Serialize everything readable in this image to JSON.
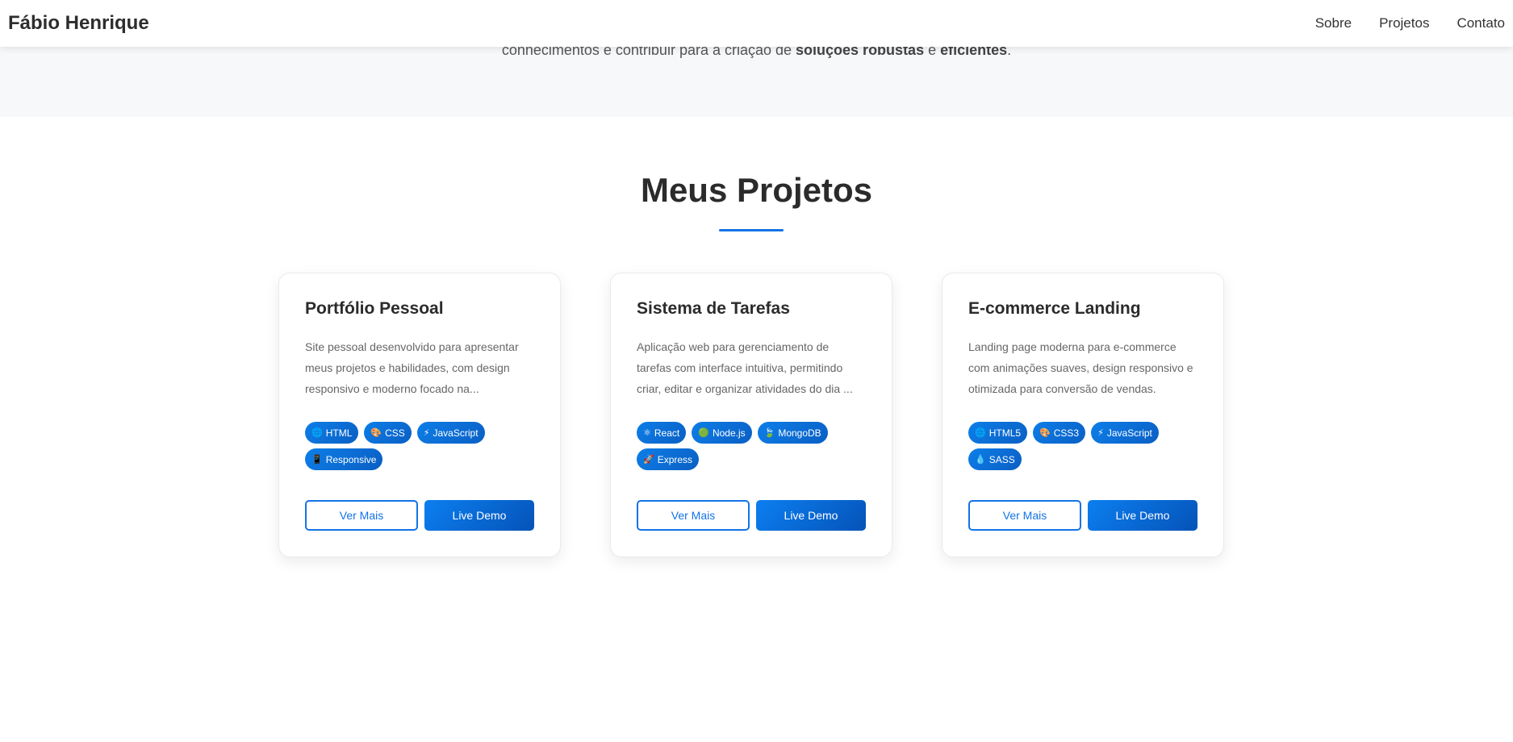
{
  "header": {
    "brand": "Fábio Henrique",
    "nav": [
      "Sobre",
      "Projetos",
      "Contato"
    ]
  },
  "about": {
    "text_before": "conhecimentos e contribuir para a criação de ",
    "bold_1": "soluções robustas",
    "text_middle": " e ",
    "bold_2": "eficientes",
    "text_after": "."
  },
  "projects": {
    "title": "Meus Projetos",
    "accent_color": "#1473e6",
    "cards": [
      {
        "title": "Portfólio Pessoal",
        "description": "Site pessoal desenvolvido para apresentar meus projetos e habilidades, com design responsivo e moderno focado na...",
        "tags": [
          {
            "icon": "🌐",
            "icon_name": "globe-icon",
            "label": "HTML"
          },
          {
            "icon": "🎨",
            "icon_name": "palette-icon",
            "label": "CSS"
          },
          {
            "icon": "⚡",
            "icon_name": "lightning-icon",
            "label": "JavaScript"
          },
          {
            "icon": "📱",
            "icon_name": "mobile-icon",
            "label": "Responsive"
          }
        ],
        "more_label": "Ver Mais",
        "demo_label": "Live Demo"
      },
      {
        "title": "Sistema de Tarefas",
        "description": "Aplicação web para gerenciamento de tarefas com interface intuitiva, permitindo criar, editar e organizar atividades do dia ...",
        "tags": [
          {
            "icon": "⚛",
            "icon_name": "atom-icon",
            "label": "React"
          },
          {
            "icon": "🟢",
            "icon_name": "green-circle-icon",
            "label": "Node.js"
          },
          {
            "icon": "🍃",
            "icon_name": "leaf-icon",
            "label": "MongoDB"
          },
          {
            "icon": "🚀",
            "icon_name": "rocket-icon",
            "label": "Express"
          }
        ],
        "more_label": "Ver Mais",
        "demo_label": "Live Demo"
      },
      {
        "title": "E-commerce Landing",
        "description": "Landing page moderna para e-commerce com animações suaves, design responsivo e otimizada para conversão de vendas.",
        "tags": [
          {
            "icon": "🌐",
            "icon_name": "globe-icon",
            "label": "HTML5"
          },
          {
            "icon": "🎨",
            "icon_name": "palette-icon",
            "label": "CSS3"
          },
          {
            "icon": "⚡",
            "icon_name": "lightning-icon",
            "label": "JavaScript"
          },
          {
            "icon": "💧",
            "icon_name": "droplet-icon",
            "label": "SASS"
          }
        ],
        "more_label": "Ver Mais",
        "demo_label": "Live Demo"
      }
    ]
  }
}
